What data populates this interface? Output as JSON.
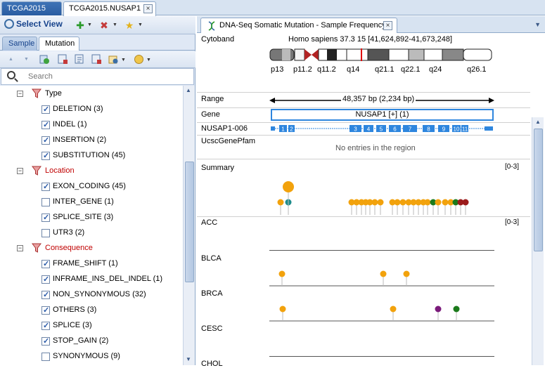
{
  "doc_tabs": [
    {
      "label": "TCGA2015"
    },
    {
      "label": "TCGA2015.NUSAP1"
    }
  ],
  "left_panel": {
    "select_view_label": "Select View",
    "sub_tabs": [
      {
        "label": "Sample"
      },
      {
        "label": "Mutation"
      }
    ],
    "search_placeholder": "Search",
    "tree": [
      {
        "kind": "group",
        "label": "Type",
        "color": "#000000"
      },
      {
        "kind": "item",
        "label": "DELETION (3)",
        "checked": true
      },
      {
        "kind": "item",
        "label": "INDEL (1)",
        "checked": true
      },
      {
        "kind": "item",
        "label": "INSERTION (2)",
        "checked": true
      },
      {
        "kind": "item",
        "label": "SUBSTITUTION (45)",
        "checked": true
      },
      {
        "kind": "group",
        "label": "Location",
        "color": "#c00000"
      },
      {
        "kind": "item",
        "label": "EXON_CODING (45)",
        "checked": true
      },
      {
        "kind": "item",
        "label": "INTER_GENE (1)",
        "checked": false
      },
      {
        "kind": "item",
        "label": "SPLICE_SITE (3)",
        "checked": true
      },
      {
        "kind": "item",
        "label": "UTR3 (2)",
        "checked": false
      },
      {
        "kind": "group",
        "label": "Consequence",
        "color": "#c00000"
      },
      {
        "kind": "item",
        "label": "FRAME_SHIFT (1)",
        "checked": true
      },
      {
        "kind": "item",
        "label": "INFRAME_INS_DEL_INDEL (1)",
        "checked": true
      },
      {
        "kind": "item",
        "label": "NON_SYNONYMOUS (32)",
        "checked": true
      },
      {
        "kind": "item",
        "label": "OTHERS (3)",
        "checked": true
      },
      {
        "kind": "item",
        "label": "SPLICE (3)",
        "checked": true
      },
      {
        "kind": "item",
        "label": "STOP_GAIN (2)",
        "checked": true
      },
      {
        "kind": "item",
        "label": "SYNONYMOUS (9)",
        "checked": false
      }
    ]
  },
  "right_panel": {
    "tab_label": "DNA-Seq Somatic Mutation - Sample Frequency",
    "cytoband": {
      "label": "Cytoband",
      "assembly": "Homo sapiens 37.3 15 [41,624,892-41,673,248]",
      "bands": [
        "p13",
        "p11.2",
        "q11.2",
        "q14",
        "q21.1",
        "q22.1",
        "q24",
        "q26.1"
      ]
    },
    "range": {
      "label": "Range",
      "text": "48,357 bp (2,234 bp)"
    },
    "gene": {
      "label": "Gene",
      "text": "NUSAP1 [+] (1)"
    },
    "transcript": {
      "label": "NUSAP1-006",
      "exons": [
        "1",
        "2",
        "3",
        "4",
        "5",
        "6",
        "7",
        "8",
        "9",
        "10",
        "11"
      ]
    },
    "pfam": {
      "label": "UcscGenePfam",
      "empty_text": "No entries in the region"
    },
    "summary": {
      "label": "Summary",
      "scale": "[0-3]"
    },
    "samples": [
      {
        "label": "ACC",
        "scale": "[0-3]"
      },
      {
        "label": "BLCA"
      },
      {
        "label": "BRCA"
      },
      {
        "label": "CESC"
      },
      {
        "label": "CHOL"
      }
    ],
    "colors": {
      "orange": "#f2a20c",
      "teal": "#1e8c8c",
      "green": "#1b7a1b",
      "purple": "#7b1b7b",
      "darkred": "#9b1b1b",
      "exon_blue": "#2e86de"
    }
  }
}
